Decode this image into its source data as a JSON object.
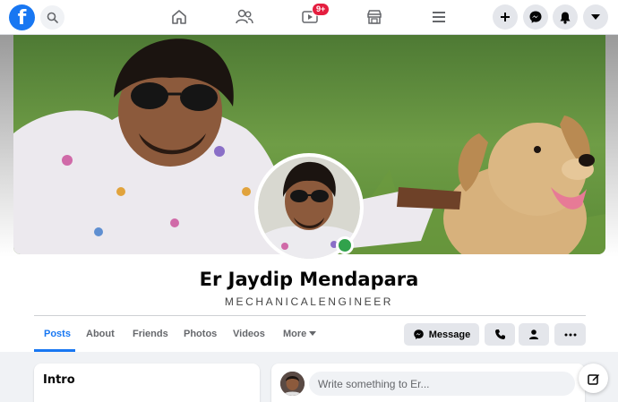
{
  "nav": {
    "icons": [
      "facebook-logo",
      "search-icon",
      "home-icon",
      "friends-icon",
      "watch-icon",
      "marketplace-icon",
      "menu-icon",
      "plus-icon",
      "messenger-icon",
      "bell-icon",
      "caret-down-icon"
    ],
    "watch_badge": "9+"
  },
  "profile": {
    "name": "Er Jaydip Mendapara",
    "bio": "MECHANICALENGINEER",
    "online": true
  },
  "tabs": [
    {
      "label": "Posts",
      "active": true
    },
    {
      "label": "About",
      "active": false
    },
    {
      "label": "Friends",
      "active": false
    },
    {
      "label": "Photos",
      "active": false
    },
    {
      "label": "Videos",
      "active": false
    },
    {
      "label": "More",
      "active": false
    }
  ],
  "actions": {
    "message_label": "Message",
    "icons": [
      "messenger-icon",
      "phone-icon",
      "add-friend-icon",
      "ellipsis-icon"
    ]
  },
  "intro": {
    "title": "Intro"
  },
  "composer": {
    "placeholder": "Write something to Er..."
  },
  "colors": {
    "brand": "#1877f2",
    "online": "#31a24c",
    "badge": "#e41e3f"
  }
}
